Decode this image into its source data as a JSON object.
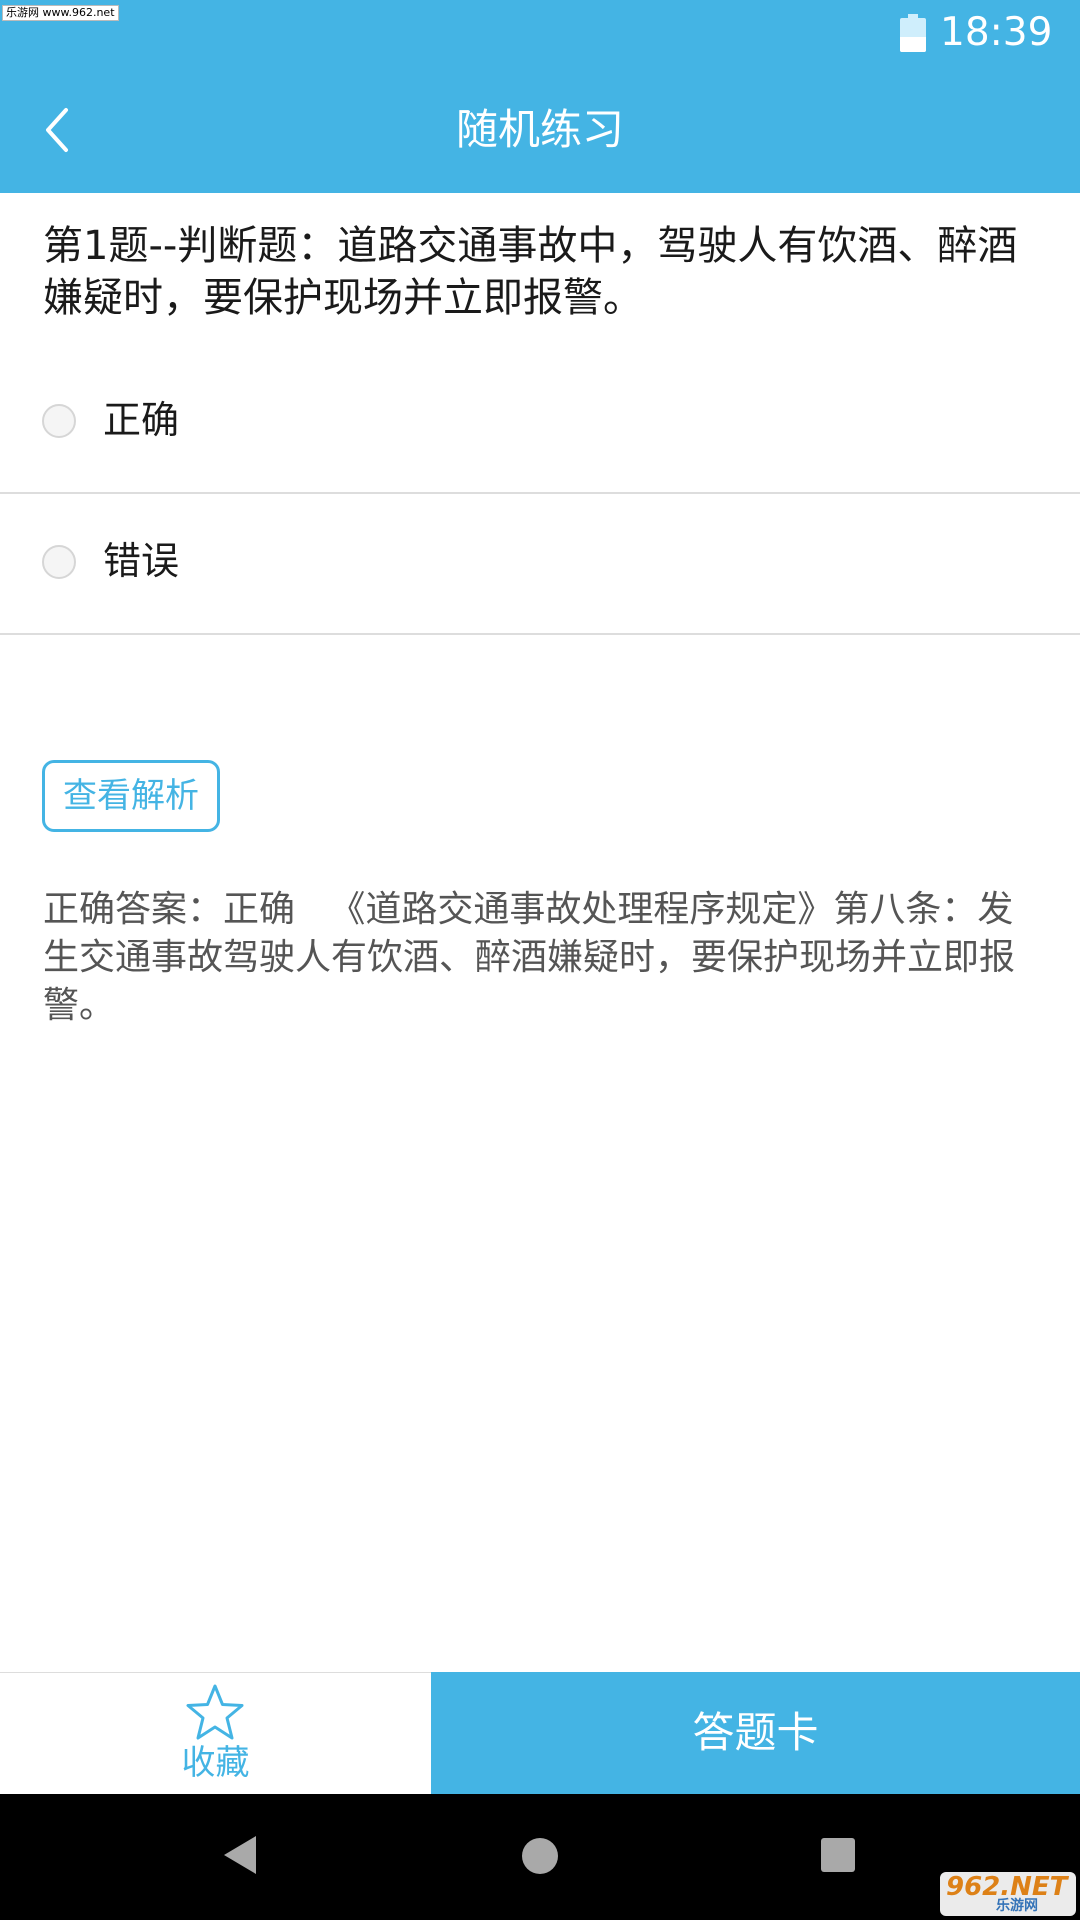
{
  "watermark": "乐游网 www.962.net",
  "status_bar": {
    "time": "18:39",
    "battery_level": 0.45
  },
  "header": {
    "title": "随机练习",
    "back_icon": "chevron-left-icon"
  },
  "question": {
    "text": "第1题--判断题：道路交通事故中，驾驶人有饮酒、醉酒嫌疑时，要保护现场并立即报警。"
  },
  "options": [
    {
      "label": "正确",
      "selected": false
    },
    {
      "label": "错误",
      "selected": false
    }
  ],
  "analysis_button": {
    "label": "查看解析"
  },
  "answer": {
    "text": "正确答案：正确   《道路交通事故处理程序规定》第八条：发生交通事故驾驶人有饮酒、醉酒嫌疑时，要保护现场并立即报警。"
  },
  "bottom_bar": {
    "favorite_label": "收藏",
    "favorite_icon": "star-icon",
    "answer_card_label": "答题卡"
  },
  "nav_bar": {
    "back_icon": "nav-back-icon",
    "home_icon": "nav-home-icon",
    "recent_icon": "nav-recent-icon"
  },
  "site_logo": {
    "main": "962.NET",
    "sub": "乐游网"
  },
  "colors": {
    "accent": "#44b4e4",
    "text": "#1a1a1a",
    "muted_text": "#555555",
    "divider": "#dddddd"
  }
}
